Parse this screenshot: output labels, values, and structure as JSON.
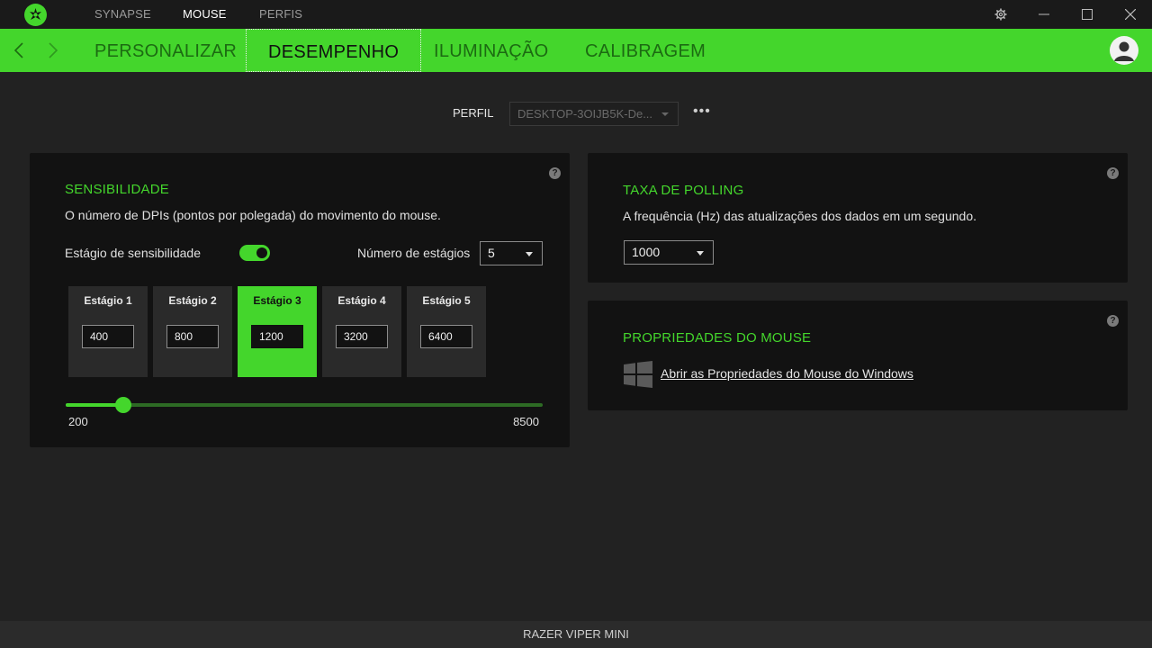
{
  "titlebar": {
    "tabs": [
      {
        "label": "SYNAPSE",
        "active": false
      },
      {
        "label": "MOUSE",
        "active": true
      },
      {
        "label": "PERFIS",
        "active": false
      }
    ]
  },
  "nav": {
    "tabs": [
      {
        "label": "PERSONALIZAR",
        "active": false
      },
      {
        "label": "DESEMPENHO",
        "active": true
      },
      {
        "label": "ILUMINAÇÃO",
        "active": false
      },
      {
        "label": "CALIBRAGEM",
        "active": false
      }
    ]
  },
  "profile": {
    "label": "PERFIL",
    "selected": "DESKTOP-3OIJB5K-De...",
    "more": "•••"
  },
  "sensitivity": {
    "title": "SENSIBILIDADE",
    "description": "O número de DPIs (pontos por polegada) do movimento do mouse.",
    "stage_toggle_label": "Estágio de sensibilidade",
    "stage_toggle_on": true,
    "stage_count_label": "Número de estágios",
    "stage_count_value": "5",
    "stages": [
      {
        "label": "Estágio 1",
        "value": "400",
        "active": false
      },
      {
        "label": "Estágio 2",
        "value": "800",
        "active": false
      },
      {
        "label": "Estágio 3",
        "value": "1200",
        "active": true
      },
      {
        "label": "Estágio 4",
        "value": "3200",
        "active": false
      },
      {
        "label": "Estágio 5",
        "value": "6400",
        "active": false
      }
    ],
    "slider": {
      "min": "200",
      "max": "8500",
      "value": 1200
    }
  },
  "polling": {
    "title": "TAXA DE POLLING",
    "description": "A frequência (Hz) das atualizações dos dados em um segundo.",
    "value": "1000"
  },
  "mouse_props": {
    "title": "PROPRIEDADES DO MOUSE",
    "link": "Abrir as Propriedades do Mouse do Windows"
  },
  "help_glyph": "?",
  "device_name": "RAZER VIPER MINI",
  "colors": {
    "accent": "#44d62c",
    "background": "#222222",
    "panel": "#121212"
  }
}
